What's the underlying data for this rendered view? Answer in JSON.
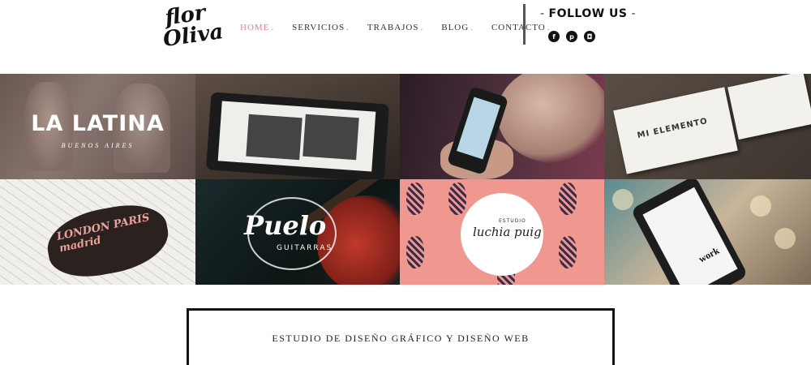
{
  "header": {
    "logo": {
      "line1": "flor",
      "line2": "Oliva"
    },
    "nav": [
      {
        "label": "HOME",
        "active": true
      },
      {
        "label": "SERVICIOS",
        "active": false
      },
      {
        "label": "TRABAJOS",
        "active": false
      },
      {
        "label": "BLOG",
        "active": false
      },
      {
        "label": "CONTACTO",
        "active": false
      }
    ],
    "nav_separator": ".",
    "follow": {
      "label": "FOLLOW US"
    },
    "socials": [
      {
        "icon": "facebook-icon",
        "glyph": "f"
      },
      {
        "icon": "pinterest-icon",
        "glyph": "p"
      },
      {
        "icon": "instagram-icon",
        "glyph": "◘"
      }
    ]
  },
  "portfolio": [
    {
      "title": "LA LATINA",
      "subtitle": "BUENOS AIRES"
    },
    {
      "title": "",
      "subtitle": ""
    },
    {
      "title": "",
      "subtitle": ""
    },
    {
      "title": "MI ELEMENTO",
      "subtitle": ""
    },
    {
      "title": "LONDON  PARIS  madrid",
      "subtitle": ""
    },
    {
      "title": "Puelo",
      "subtitle": "GUITARRAS"
    },
    {
      "title": "luchia puig",
      "subtitle": "ESTUDIO"
    },
    {
      "title": "work",
      "subtitle": ""
    }
  ],
  "intro": {
    "text": "ESTUDIO DE DISEÑO GRÁFICO Y DISEÑO WEB"
  },
  "colors": {
    "accent": "#e9847f",
    "text": "#222222",
    "pineapple_bg": "#f0978f"
  }
}
